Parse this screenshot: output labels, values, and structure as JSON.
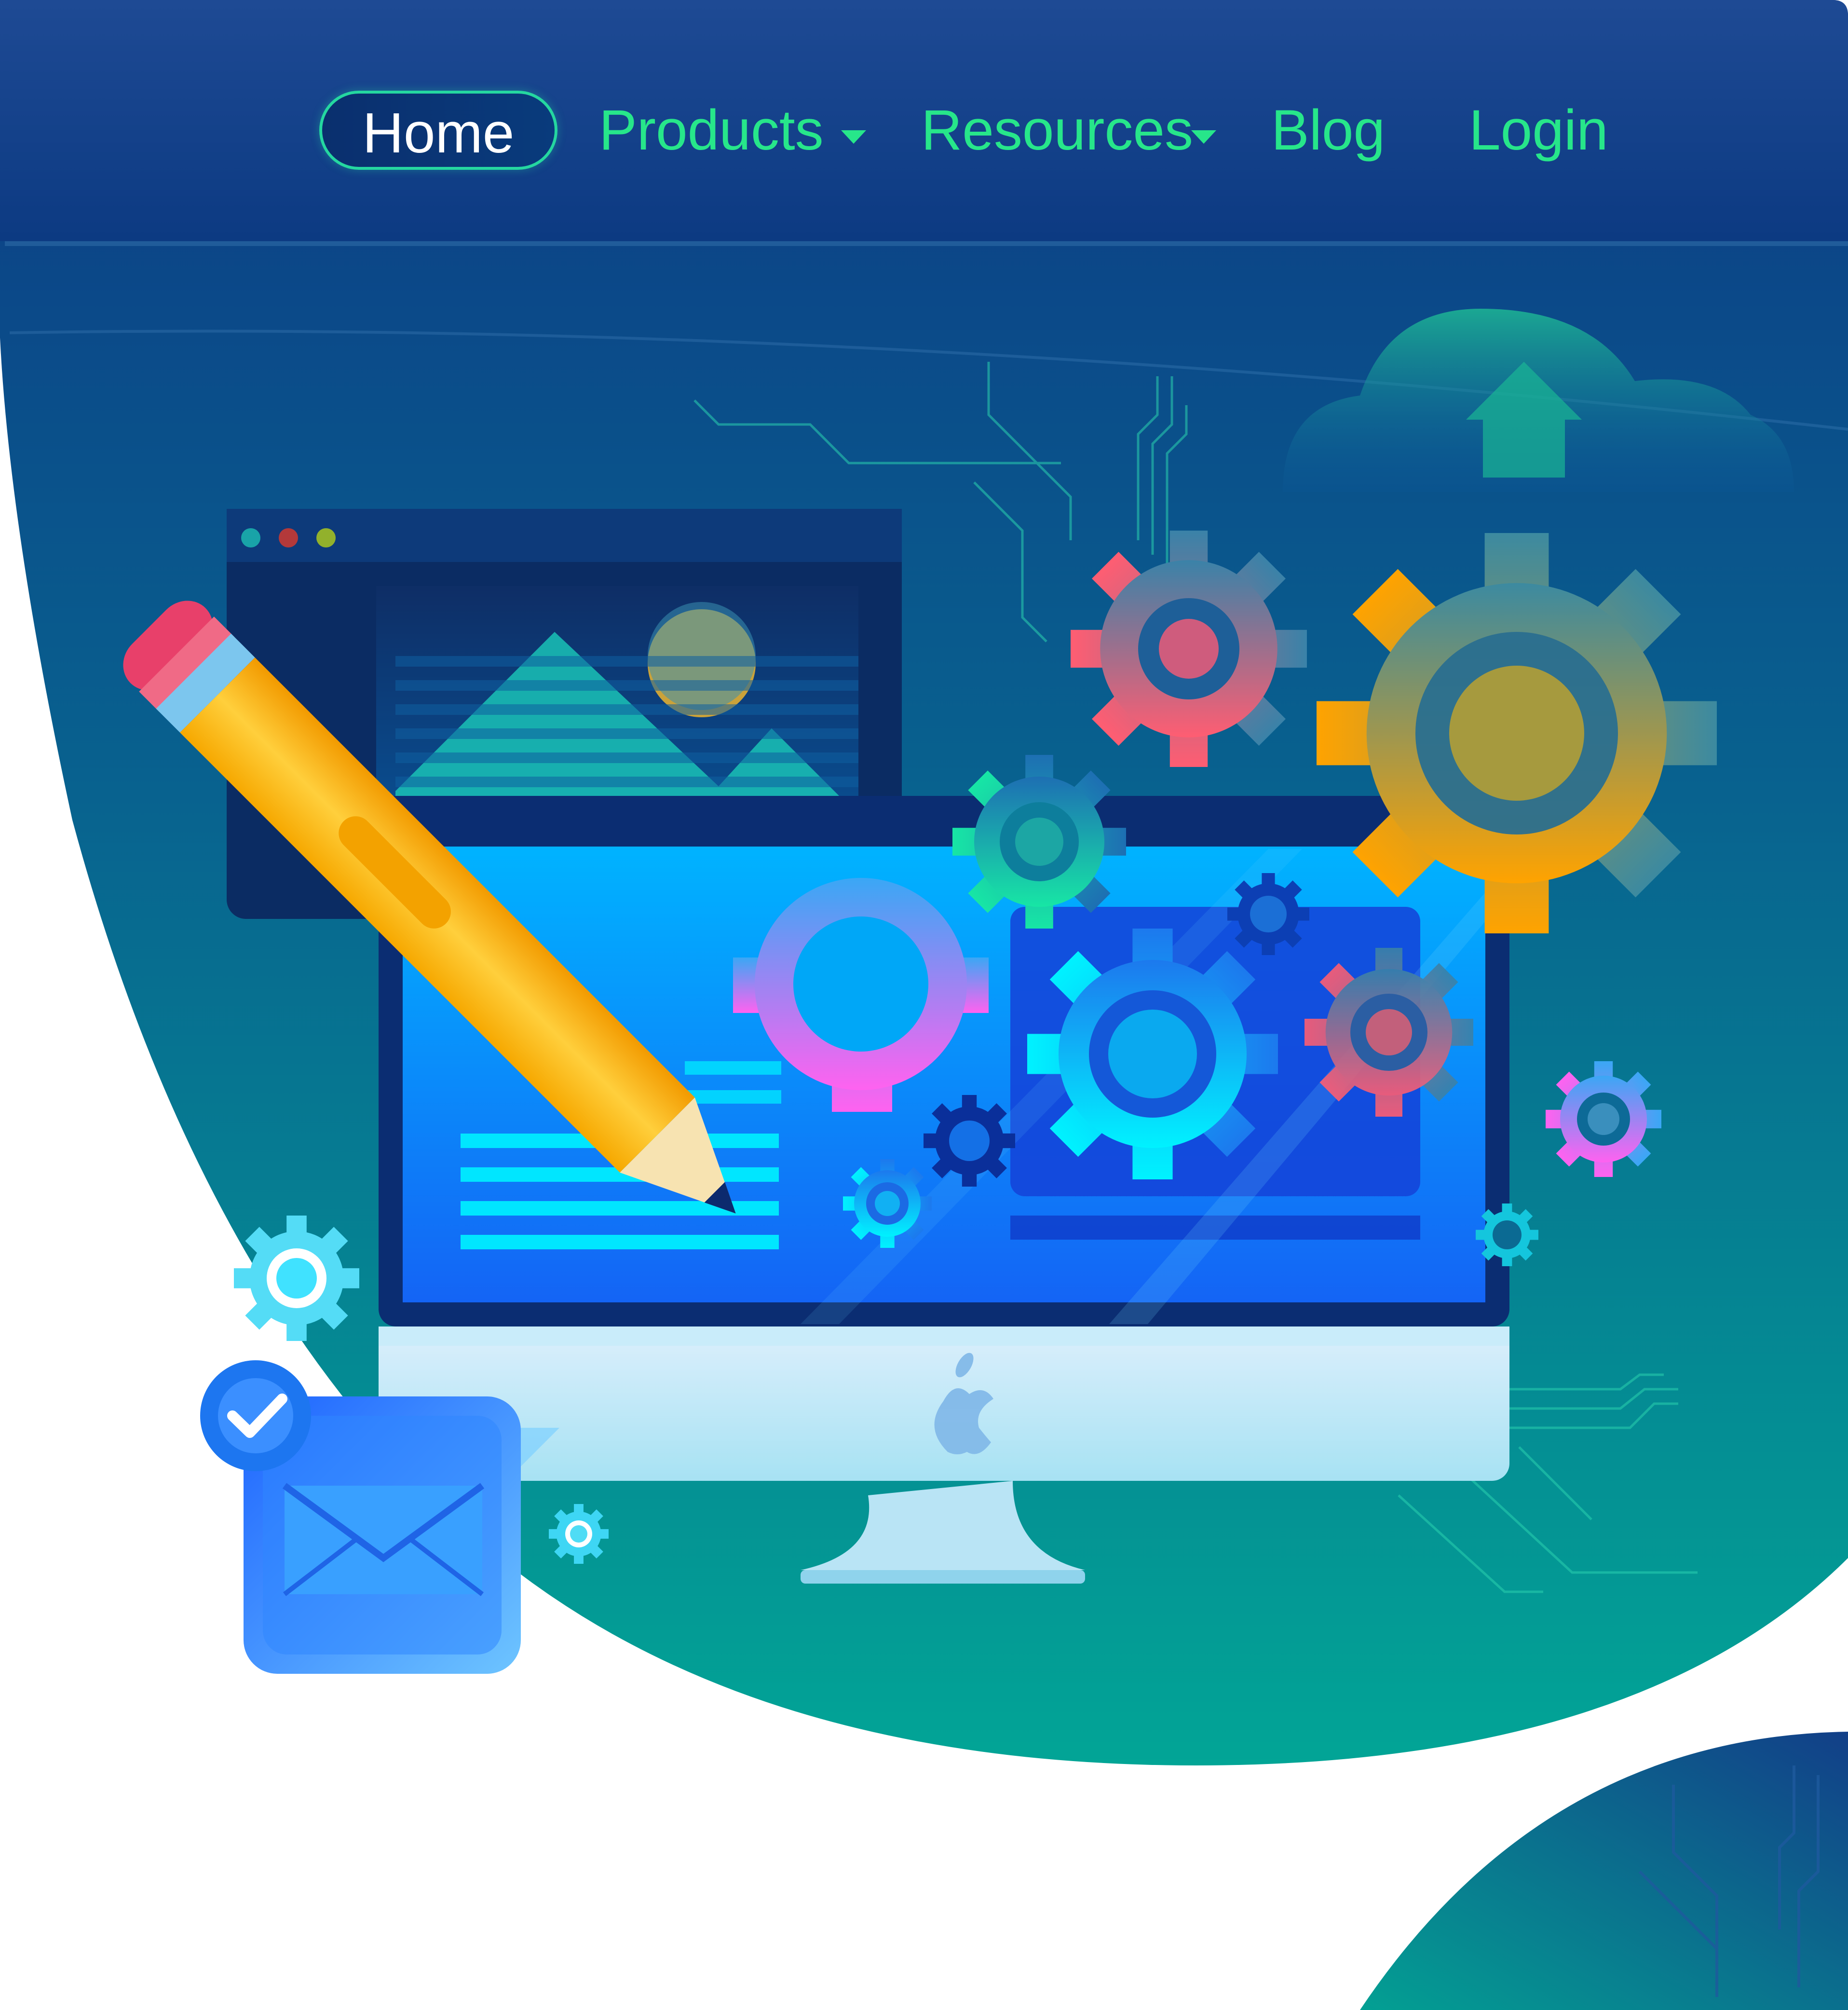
{
  "nav": {
    "home": "Home",
    "products": "Products",
    "resources": "Resources",
    "blog": "Blog",
    "login": "Login",
    "active": "Home",
    "dropdown_items": [
      "Products",
      "Resources"
    ]
  },
  "colors": {
    "header_bg": "#143a86",
    "nav_text": "#27e68a",
    "active_text": "#ffffff",
    "active_border": "#25d7a0",
    "hero_top": "#0b3f83",
    "hero_bottom": "#03a497",
    "white": "#ffffff"
  },
  "illustration": {
    "icons": [
      "pencil-icon",
      "monitor-icon",
      "image-window-icon",
      "cloud-upload-icon",
      "gear-icon",
      "mail-icon",
      "check-icon",
      "apple-logo-icon"
    ]
  }
}
